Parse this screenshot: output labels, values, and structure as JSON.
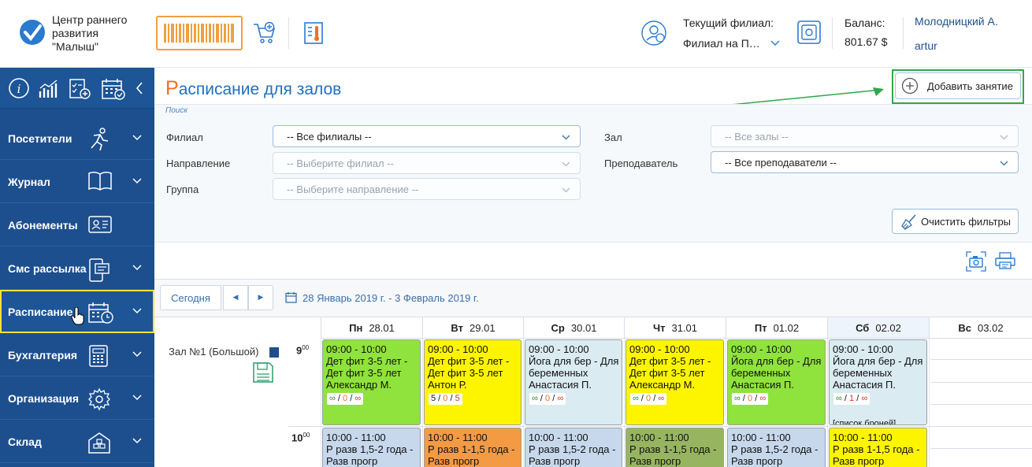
{
  "header": {
    "org_name_line1": "Центр раннего",
    "org_name_line2": "развития",
    "org_name_line3": "\"Малыш\"",
    "branch_caption": "Текущий филиал:",
    "branch_value": "Филиал на П…",
    "balance_caption": "Баланс:",
    "balance_value": "801.67 $",
    "user_name": "Молодницкий А.",
    "user_login": "artur"
  },
  "sidebar": {
    "items": [
      {
        "label": "Посетители",
        "icon": "runner-icon"
      },
      {
        "label": "Журнал",
        "icon": "book-icon"
      },
      {
        "label": "Абонементы",
        "icon": "id-card-icon"
      },
      {
        "label": "Смс рассылка",
        "icon": "phone-message-icon"
      },
      {
        "label": "Расписание",
        "icon": "calendar-clock-icon"
      },
      {
        "label": "Бухгалтерия",
        "icon": "calculator-icon"
      },
      {
        "label": "Организация",
        "icon": "gear-icon"
      },
      {
        "label": "Склад",
        "icon": "warehouse-icon"
      }
    ],
    "active": "Расписание"
  },
  "page": {
    "title_first": "Р",
    "title_rest": "асписание для залов",
    "add_button": "Добавить занятие"
  },
  "filters": {
    "search_caption": "Поиск",
    "branch_label": "Филиал",
    "branch_value": "-- Все филиалы --",
    "direction_label": "Направление",
    "direction_value": "-- Выберите филиал --",
    "group_label": "Группа",
    "group_value": "-- Выберите направление --",
    "hall_label": "Зал",
    "hall_value": "-- Все залы --",
    "teacher_label": "Преподаватель",
    "teacher_value": "-- Все преподаватели --",
    "clear_button": "Очистить фильтры"
  },
  "schedule": {
    "today_button": "Сегодня",
    "prev": "◀",
    "next": "▶",
    "date_range": "28 Январь 2019 г. - 3 Февраль 2019 г.",
    "days": [
      {
        "name": "Пн",
        "date": "28.01"
      },
      {
        "name": "Вт",
        "date": "29.01"
      },
      {
        "name": "Ср",
        "date": "30.01"
      },
      {
        "name": "Чт",
        "date": "31.01"
      },
      {
        "name": "Пт",
        "date": "01.02"
      },
      {
        "name": "Сб",
        "date": "02.02"
      },
      {
        "name": "Вс",
        "date": "03.02"
      }
    ],
    "room": "Зал №1 (Большой)",
    "hours": [
      {
        "h": "9",
        "m": "00"
      },
      {
        "h": "10",
        "m": "00"
      }
    ],
    "events_9": [
      {
        "time": "09:00 - 10:00",
        "l1": "Дет фит 3-5 лет -",
        "l2": "Дет фит 3-5 лет",
        "l3": "Александр М.",
        "c1": "∞",
        "c2": "0",
        "c3": "∞",
        "color": "#8fe33c"
      },
      {
        "time": "09:00 - 10:00",
        "l1": "Дет фит 3-5 лет -",
        "l2": "Дет фит 3-5 лет",
        "l3": "Антон Р.",
        "c1": "5",
        "c2": "0",
        "c3": "5",
        "color": "#fdf400"
      },
      {
        "time": "09:00 - 10:00",
        "l1": "Йога для бер - Для",
        "l2": "беременных",
        "l3": "Анастасия П.",
        "c1": "∞",
        "c2": "0",
        "c3": "∞",
        "color": "#daebf2"
      },
      {
        "time": "09:00 - 10:00",
        "l1": "Дет фит 3-5 лет -",
        "l2": "Дет фит 3-5 лет",
        "l3": "Александр М.",
        "c1": "∞",
        "c2": "0",
        "c3": "∞",
        "color": "#fdf400"
      },
      {
        "time": "09:00 - 10:00",
        "l1": "Йога для бер - Для",
        "l2": "беременных",
        "l3": "Анастасия П.",
        "c1": "∞",
        "c2": "0",
        "c3": "∞",
        "color": "#8fe33c"
      },
      {
        "time": "09:00 - 10:00",
        "l1": "Йога для бер - Для",
        "l2": "беременных",
        "l3": "Анастасия П.",
        "c1": "∞",
        "c2": "1",
        "c3": "∞",
        "color": "#daebf2",
        "extra": "[список броней]"
      }
    ],
    "events_10": [
      {
        "time": "10:00 - 11:00",
        "l1": "Р разв 1,5-2 года -",
        "l2": "Разв прогр",
        "color": "#c7d8ec"
      },
      {
        "time": "10:00 - 11:00",
        "l1": "Р разв 1-1,5 года -",
        "l2": "Разв прогр",
        "color": "#f39a45"
      },
      {
        "time": "10:00 - 11:00",
        "l1": "Р разв 1,5-2 года -",
        "l2": "Разв прогр",
        "color": "#c7d8ec"
      },
      {
        "time": "10:00 - 11:00",
        "l1": "Р разв 1-1,5 года -",
        "l2": "Разв прогр",
        "color": "#97b560"
      },
      {
        "time": "10:00 - 11:00",
        "l1": "Р разв 1,5-2 года -",
        "l2": "Разв прогр",
        "color": "#c7d8ec"
      },
      {
        "time": "10:00 - 11:00",
        "l1": "Р разв 1-1,5 года -",
        "l2": "Разв прогр",
        "color": "#fdf400"
      }
    ]
  }
}
